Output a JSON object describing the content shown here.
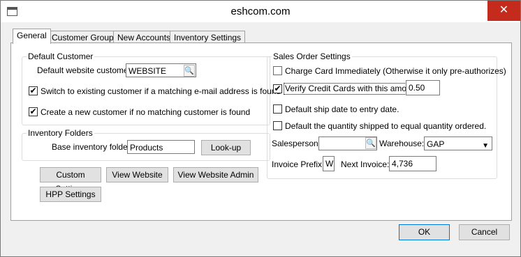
{
  "window": {
    "title": "eshcom.com",
    "close_icon": "close-icon"
  },
  "tabs": [
    {
      "label": "General"
    },
    {
      "label": "Customer Groups"
    },
    {
      "label": "New Accounts"
    },
    {
      "label": "Inventory Settings"
    }
  ],
  "default_customer": {
    "group_label": "Default Customer",
    "website_customer_label": "Default website customer:",
    "website_customer_value": "WEBSITE",
    "switch_existing_label": "Switch to existing customer if a matching e-mail address is found",
    "switch_existing_checked": true,
    "create_new_label": "Create a new customer if no matching customer is found",
    "create_new_checked": true
  },
  "inventory_folders": {
    "group_label": "Inventory Folders",
    "base_folder_label": "Base inventory folder:",
    "base_folder_value": "Products",
    "lookup_button": "Look-up"
  },
  "buttons": {
    "custom_settings": "Custom Settings",
    "view_website": "View Website",
    "view_website_admin": "View Website Admin",
    "hpp_settings": "HPP Settings",
    "ok": "OK",
    "cancel": "Cancel"
  },
  "sales_order": {
    "group_label": "Sales Order Settings",
    "charge_card_label": "Charge Card Immediately (Otherwise it only pre-authorizes)",
    "charge_card_checked": false,
    "verify_cards_label": "Verify Credit Cards with this amount:",
    "verify_cards_checked": true,
    "verify_amount": "0.50",
    "default_ship_label": "Default ship date to entry date.",
    "default_ship_checked": false,
    "default_qty_label": "Default the quantity shipped to equal quantity ordered.",
    "default_qty_checked": false,
    "salesperson_label": "Salesperson:",
    "salesperson_value": "",
    "warehouse_label": "Warehouse:",
    "warehouse_value": "GAP",
    "invoice_prefix_label": "Invoice Prefix:",
    "invoice_prefix_value": "W",
    "next_invoice_label": "Next Invoice:",
    "next_invoice_value": "4,736"
  }
}
